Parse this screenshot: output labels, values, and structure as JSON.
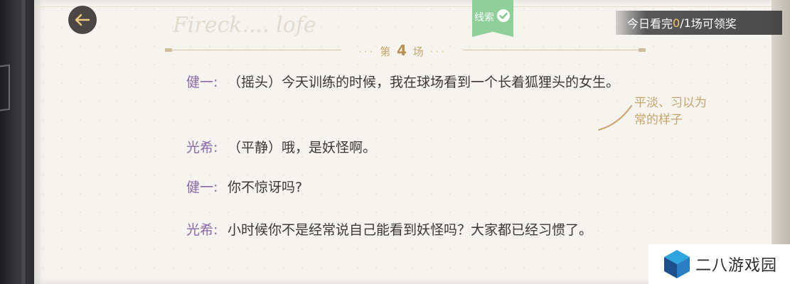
{
  "header": {
    "clue_tab": {
      "label": "线索",
      "status": "completed"
    },
    "reward": {
      "prefix": "今日看完 ",
      "done": "0",
      "total_sep": "/1",
      "suffix": " 场可领奖"
    },
    "watermark": "Fireck.... lofe"
  },
  "scene": {
    "dots_left": "···",
    "prefix": "第",
    "number": "4",
    "suffix": "场",
    "dots_right": "···"
  },
  "dialogue": [
    {
      "speaker": "健一:",
      "text": "（摇头）今天训练的时候，我在球场看到一个长着狐狸头的女生。"
    },
    {
      "speaker": "光希:",
      "text": "（平静）哦，是妖怪啊。"
    },
    {
      "speaker": "健一:",
      "text": "你不惊讶吗?"
    },
    {
      "speaker": "光希:",
      "text": "小时候你不是经常说自己能看到妖怪吗？大家都已经习惯了。"
    }
  ],
  "annotation": {
    "text": "平淡、习以为常的样子"
  },
  "logo": {
    "text": "二八游戏园"
  },
  "colors": {
    "speaker": "#8a68a8",
    "accent_gold": "#c9a66a",
    "clue_green": "#8fd09a",
    "paper": "#f6f4ef"
  },
  "icons": {
    "back": "back-arrow-icon",
    "check": "check-circle-icon",
    "logo": "cube-logo-icon"
  }
}
